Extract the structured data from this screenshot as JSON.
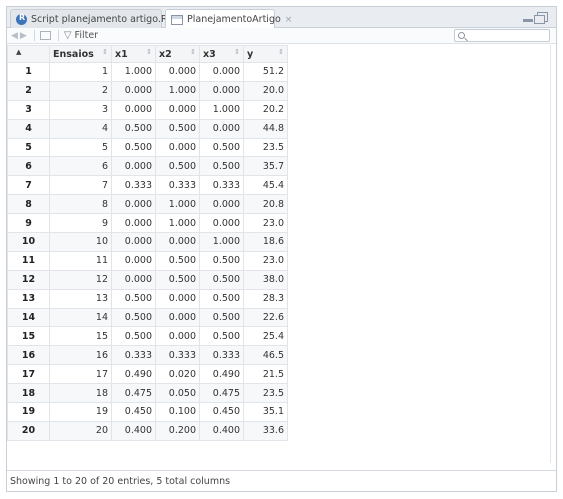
{
  "tabs": [
    {
      "label": "Script planejamento artigo.R",
      "close": "×"
    },
    {
      "label": "PlanejamentoArtigo",
      "close": "×"
    }
  ],
  "toolbar": {
    "filter_label": "Filter",
    "search_placeholder": ""
  },
  "table": {
    "columns": [
      "",
      "Ensaios",
      "x1",
      "x2",
      "x3",
      "y"
    ],
    "rows": [
      [
        "1",
        "1",
        "1.000",
        "0.000",
        "0.000",
        "51.2"
      ],
      [
        "2",
        "2",
        "0.000",
        "1.000",
        "0.000",
        "20.0"
      ],
      [
        "3",
        "3",
        "0.000",
        "0.000",
        "1.000",
        "20.2"
      ],
      [
        "4",
        "4",
        "0.500",
        "0.500",
        "0.000",
        "44.8"
      ],
      [
        "5",
        "5",
        "0.500",
        "0.000",
        "0.500",
        "23.5"
      ],
      [
        "6",
        "6",
        "0.000",
        "0.500",
        "0.500",
        "35.7"
      ],
      [
        "7",
        "7",
        "0.333",
        "0.333",
        "0.333",
        "45.4"
      ],
      [
        "8",
        "8",
        "0.000",
        "1.000",
        "0.000",
        "20.8"
      ],
      [
        "9",
        "9",
        "0.000",
        "1.000",
        "0.000",
        "23.0"
      ],
      [
        "10",
        "10",
        "0.000",
        "0.000",
        "1.000",
        "18.6"
      ],
      [
        "11",
        "11",
        "0.000",
        "0.500",
        "0.500",
        "23.0"
      ],
      [
        "12",
        "12",
        "0.000",
        "0.500",
        "0.500",
        "38.0"
      ],
      [
        "13",
        "13",
        "0.500",
        "0.000",
        "0.500",
        "28.3"
      ],
      [
        "14",
        "14",
        "0.500",
        "0.000",
        "0.500",
        "22.6"
      ],
      [
        "15",
        "15",
        "0.500",
        "0.000",
        "0.500",
        "25.4"
      ],
      [
        "16",
        "16",
        "0.333",
        "0.333",
        "0.333",
        "46.5"
      ],
      [
        "17",
        "17",
        "0.490",
        "0.020",
        "0.490",
        "21.5"
      ],
      [
        "18",
        "18",
        "0.475",
        "0.050",
        "0.475",
        "23.5"
      ],
      [
        "19",
        "19",
        "0.450",
        "0.100",
        "0.450",
        "35.1"
      ],
      [
        "20",
        "20",
        "0.400",
        "0.200",
        "0.400",
        "33.6"
      ]
    ]
  },
  "status": {
    "text": "Showing 1 to 20 of 20 entries, 5 total columns"
  },
  "icons": {
    "tab1": "r-script-icon",
    "tab2": "data-table-icon",
    "search": "search-icon",
    "filter": "filter-icon"
  }
}
